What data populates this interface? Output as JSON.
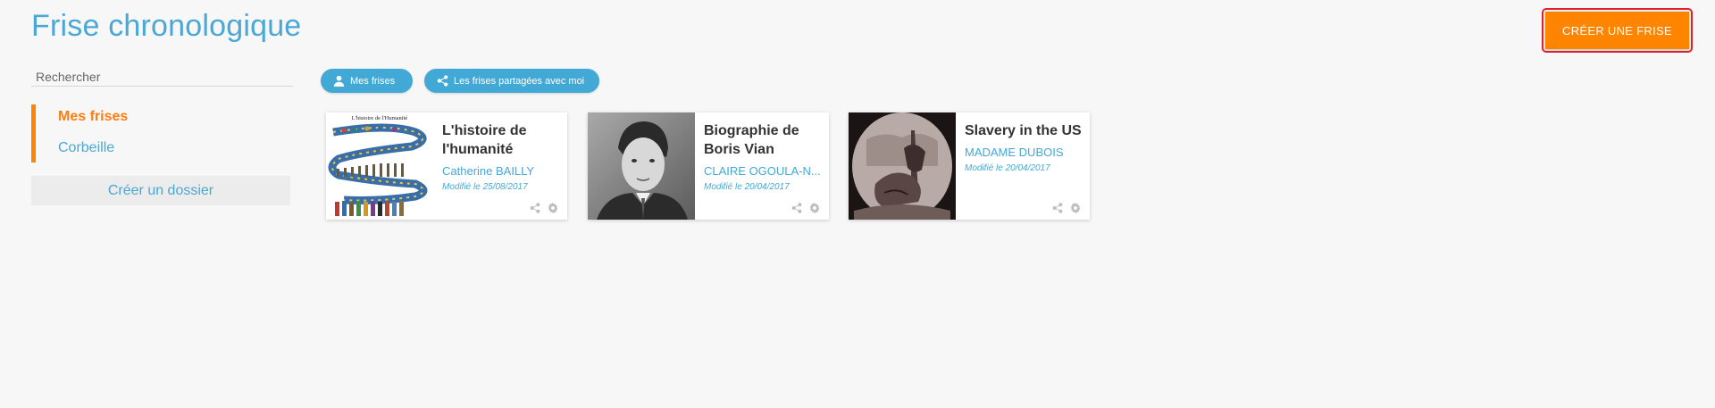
{
  "header": {
    "title": "Frise chronologique",
    "create_label": "CRÉER UNE FRISE"
  },
  "sidebar": {
    "search_placeholder": "Rechercher",
    "items": [
      {
        "label": "Mes frises",
        "active": true
      },
      {
        "label": "Corbeille",
        "active": false
      }
    ],
    "create_folder_label": "Créer un dossier"
  },
  "filters": {
    "mine_label": "Mes frises",
    "shared_label": "Les frises partagées avec moi"
  },
  "cards": [
    {
      "title": "L'histoire de l'humanité",
      "author": "Catherine BAILLY",
      "modified": "Modifié le 25/08/2017",
      "thumb_caption": "L'histoire de l'Humanité"
    },
    {
      "title": "Biographie de Boris Vian",
      "author": "CLAIRE OGOULA-N...",
      "modified": "Modifié le 20/04/2017"
    },
    {
      "title": "Slavery in the US",
      "author": "MADAME DUBOIS",
      "modified": "Modifié le 20/04/2017"
    }
  ],
  "colors": {
    "accent_orange": "#ff8400",
    "accent_blue": "#42a9d6",
    "title_blue": "#4aa8d4",
    "highlight_red": "#e0202e"
  }
}
